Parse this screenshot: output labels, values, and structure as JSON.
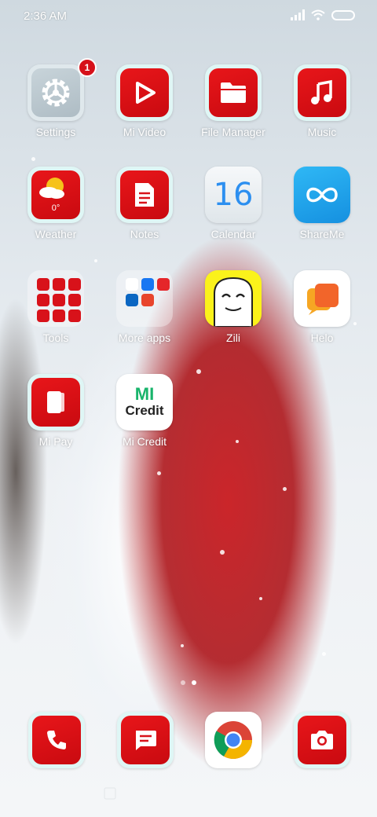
{
  "status_bar": {
    "time": "2:36 AM"
  },
  "apps": [
    {
      "label": "Settings",
      "icon": "gear-icon",
      "badge": "1"
    },
    {
      "label": "Mi Video",
      "icon": "play-icon"
    },
    {
      "label": "File Manager",
      "icon": "folder-icon"
    },
    {
      "label": "Music",
      "icon": "music-note-icon"
    },
    {
      "label": "Weather",
      "icon": "weather-icon",
      "temp": "0°"
    },
    {
      "label": "Notes",
      "icon": "note-icon"
    },
    {
      "label": "Calendar",
      "icon": "calendar-icon",
      "day": "16"
    },
    {
      "label": "ShareMe",
      "icon": "infinity-icon"
    },
    {
      "label": "Tools",
      "icon": "tools-folder-icon"
    },
    {
      "label": "More apps",
      "icon": "more-apps-folder-icon"
    },
    {
      "label": "Zili",
      "icon": "zili-icon"
    },
    {
      "label": "Helo",
      "icon": "helo-icon"
    },
    {
      "label": "Mi Pay",
      "icon": "wallet-icon"
    },
    {
      "label": "Mi Credit",
      "icon": "mi-credit-icon",
      "logo_top": "MI",
      "logo_bottom": "Credit"
    }
  ],
  "dock": [
    {
      "icon": "phone-icon"
    },
    {
      "icon": "message-icon"
    },
    {
      "icon": "chrome-icon"
    },
    {
      "icon": "camera-icon"
    }
  ],
  "colors": {
    "accent_red": "#d8121a",
    "tile_bg": "#dff6f5"
  }
}
